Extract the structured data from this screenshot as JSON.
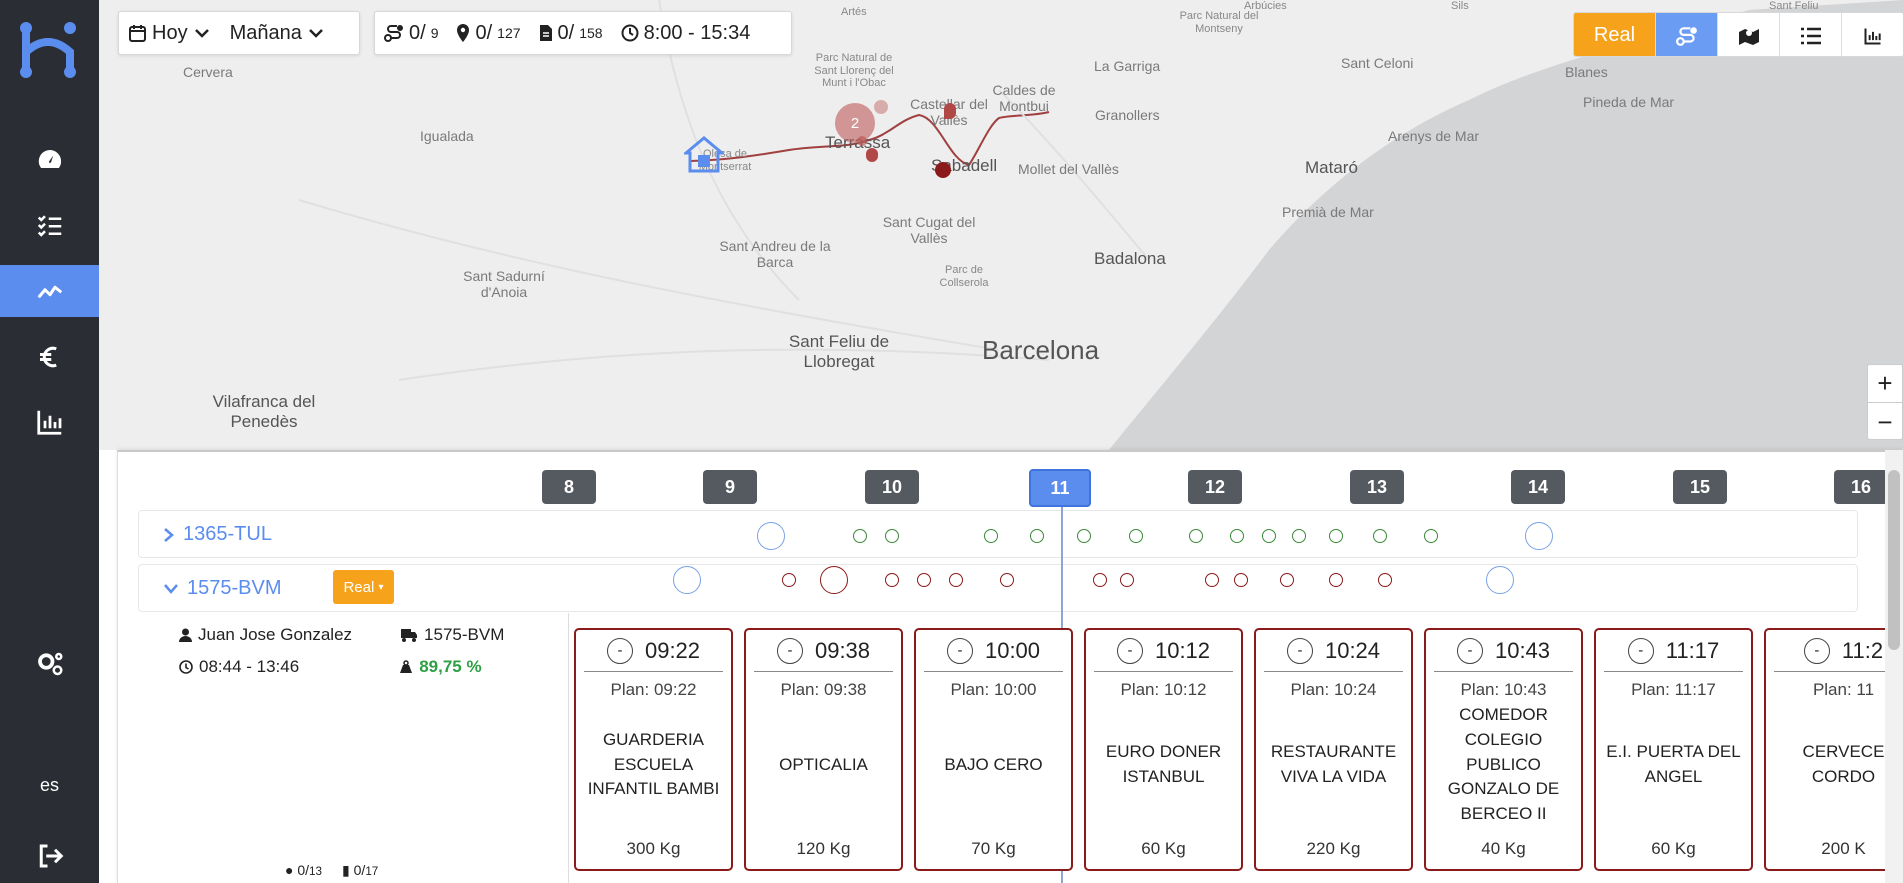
{
  "sidebar": {
    "icons": [
      "dashboard-icon",
      "tasks-icon",
      "analytics-icon",
      "euro-icon",
      "bar-chart-icon",
      "settings-icon",
      "logout-icon"
    ],
    "language": "es"
  },
  "toolbar": {
    "day_today": "Hoy",
    "day_tomorrow": "Mañana",
    "routes": "0/",
    "routes_total": "9",
    "stops": "0/",
    "stops_total": "127",
    "orders": "0/",
    "orders_total": "158",
    "time_range": "8:00 - 15:34",
    "real_label": "Real"
  },
  "map": {
    "labels": [
      "Artés",
      "Parc Natural de Sant Llorenç del Munt i l'Obac",
      "Parc Natural del Montseny",
      "Cervera",
      "Castellar del Vallès",
      "Caldes de Montbui",
      "La Garriga",
      "Sant Celoni",
      "Blanes",
      "Pineda de Mar",
      "Igualada",
      "Terrassa",
      "Sabadell",
      "Mollet del Vallès",
      "Granollers",
      "Arenys de Mar",
      "Mataró",
      "Sant Cugat del Vallès",
      "Premià de Mar",
      "Sant Andreu de la Barca",
      "Sant Sadurní d'Anoia",
      "Parc de Collserola",
      "Badalona",
      "Sant Feliu de Llobregat",
      "Barcelona",
      "Vilafranca del Penedès",
      "Arbúcies",
      "Sils",
      "Sant Feliu",
      "Olesa de Montserrat"
    ],
    "cluster_count": "2",
    "zoom_in": "+",
    "zoom_out": "−"
  },
  "timeline": {
    "hours": [
      "8",
      "9",
      "10",
      "11",
      "12",
      "13",
      "14",
      "15",
      "16"
    ],
    "current_hour": "11"
  },
  "rows": [
    {
      "id": "1365-TUL",
      "expanded": false
    },
    {
      "id": "1575-BVM",
      "expanded": true,
      "badge": "Real"
    }
  ],
  "driver": {
    "name": "Juan Jose Gonzalez",
    "vehicle": "1575-BVM",
    "schedule": "08:44 - 13:46",
    "load": "89,75 %",
    "stops": "0/",
    "stops_total": "13",
    "orders": "0/",
    "orders_total": "17"
  },
  "stops": [
    {
      "time": "09:22",
      "plan": "Plan: 09:22",
      "name": "GUARDERIA ESCUELA INFANTIL BAMBI",
      "kg": "300 Kg"
    },
    {
      "time": "09:38",
      "plan": "Plan: 09:38",
      "name": "OPTICALIA",
      "kg": "120 Kg"
    },
    {
      "time": "10:00",
      "plan": "Plan: 10:00",
      "name": "BAJO CERO",
      "kg": "70 Kg"
    },
    {
      "time": "10:12",
      "plan": "Plan: 10:12",
      "name": "EURO DONER ISTANBUL",
      "kg": "60 Kg"
    },
    {
      "time": "10:24",
      "plan": "Plan: 10:24",
      "name": "RESTAURANTE VIVA LA VIDA",
      "kg": "220 Kg"
    },
    {
      "time": "10:43",
      "plan": "Plan: 10:43",
      "name": "COMEDOR COLEGIO PUBLICO GONZALO DE BERCEO II",
      "kg": "40 Kg"
    },
    {
      "time": "11:17",
      "plan": "Plan: 11:17",
      "name": "E.I. PUERTA DEL ANGEL",
      "kg": "60 Kg"
    },
    {
      "time": "11:2",
      "plan": "Plan: 11",
      "name": "CERVECE CORDO",
      "kg": "200 K"
    }
  ],
  "colors": {
    "sidebar_bg": "#2a2d33",
    "accent_blue": "#5b8def",
    "real_orange": "#f7a21b",
    "stop_border": "#8b1a1a",
    "done_green": "#2ea043"
  }
}
